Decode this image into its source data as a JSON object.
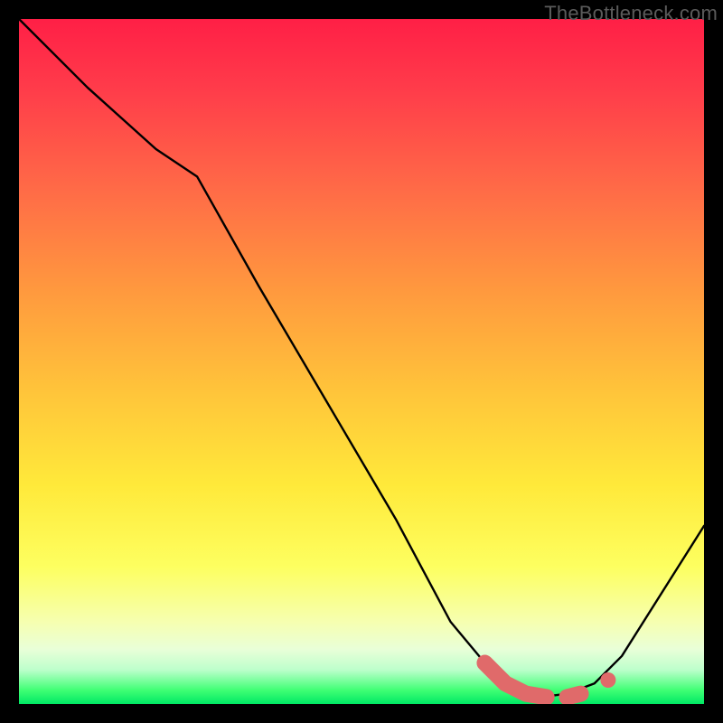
{
  "watermark": "TheBottleneck.com",
  "colors": {
    "curve_stroke": "#000000",
    "marker_fill": "#e06a6a",
    "marker_stroke": "#d85f5f"
  },
  "chart_data": {
    "type": "line",
    "title": "",
    "xlabel": "",
    "ylabel": "",
    "xlim": [
      0,
      100
    ],
    "ylim": [
      0,
      100
    ],
    "annotations": [],
    "series": [
      {
        "name": "bottleneck-curve",
        "x": [
          0,
          10,
          20,
          26,
          35,
          45,
          55,
          63,
          68,
          72,
          76,
          80,
          84,
          88,
          100
        ],
        "y": [
          100,
          90,
          81,
          77,
          61,
          44,
          27,
          12,
          6,
          2.5,
          1,
          1.5,
          3,
          7,
          26
        ]
      }
    ],
    "markers": [
      {
        "name": "highlight-elbow-start",
        "x": 68,
        "y": 6
      },
      {
        "name": "highlight-elbow-mid",
        "x": 71,
        "y": 3
      },
      {
        "name": "highlight-flat-a",
        "x": 74,
        "y": 1.5
      },
      {
        "name": "highlight-flat-b",
        "x": 77,
        "y": 1
      },
      {
        "name": "highlight-gap-a",
        "x": 80,
        "y": 1
      },
      {
        "name": "highlight-gap-b",
        "x": 82,
        "y": 1.5
      },
      {
        "name": "highlight-dot",
        "x": 86,
        "y": 3.5
      }
    ]
  }
}
